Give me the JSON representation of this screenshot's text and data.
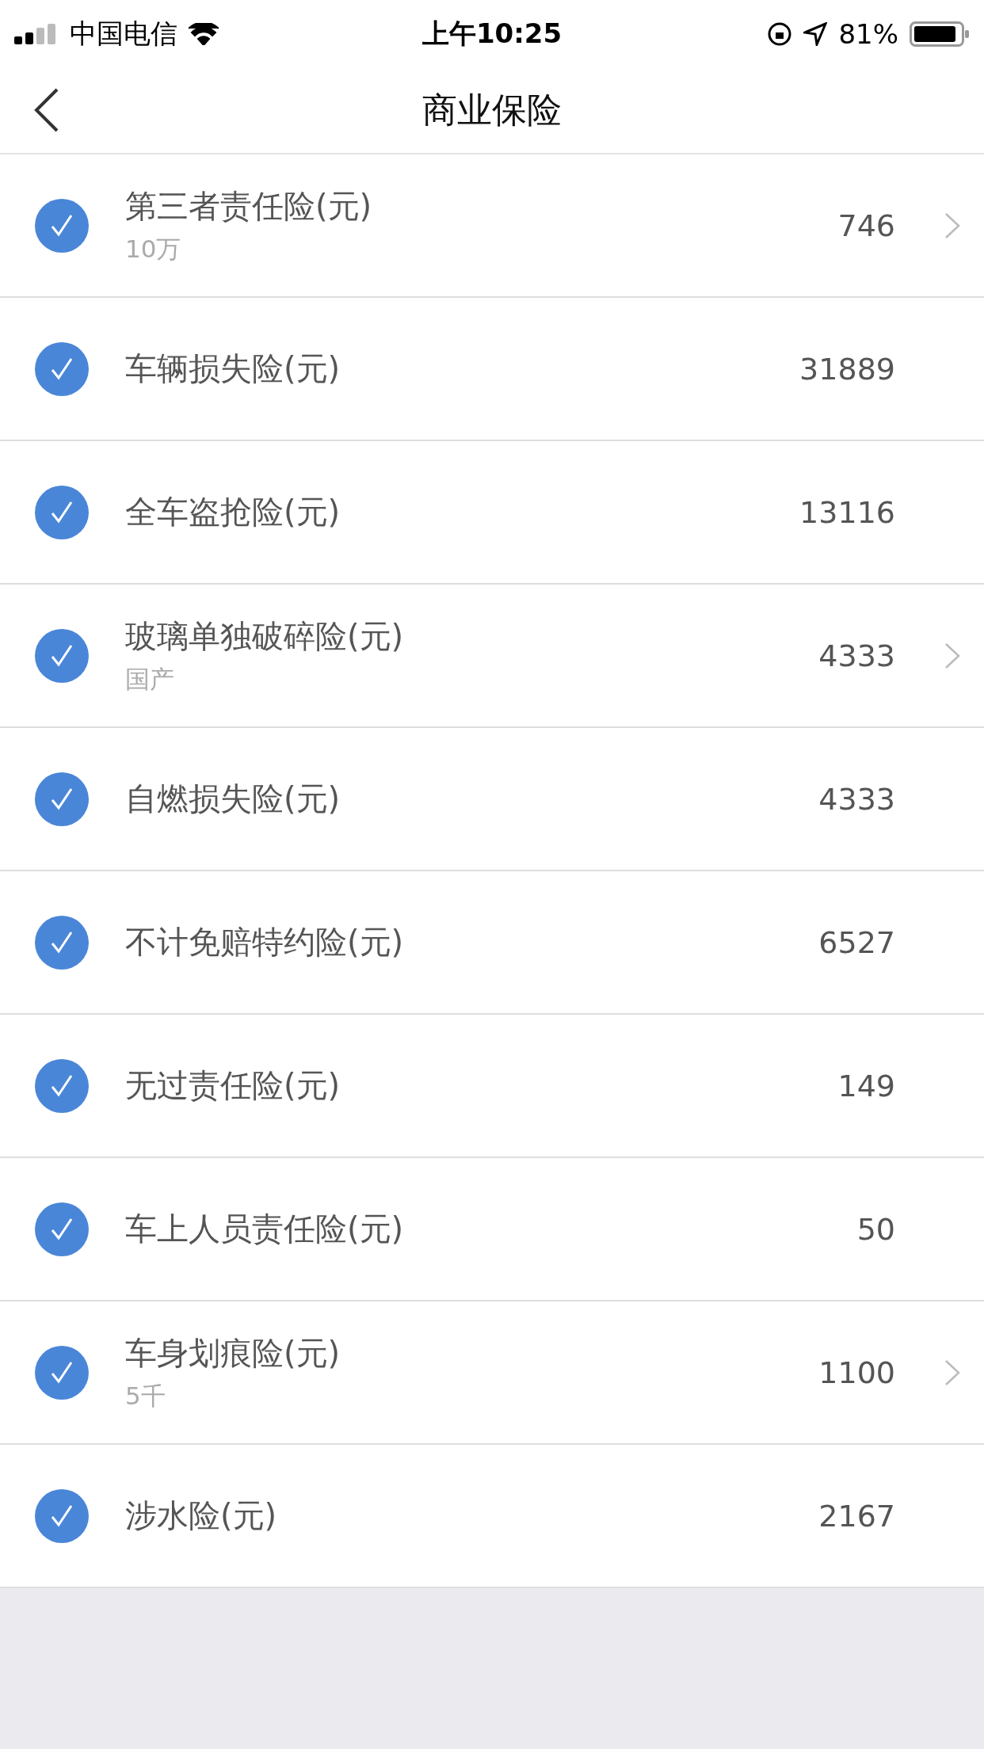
{
  "status_bar": {
    "carrier": "中国电信",
    "time": "上午10:25",
    "battery": "81%"
  },
  "nav": {
    "title": "商业保险"
  },
  "items": [
    {
      "label": "第三者责任险(元)",
      "sub": "10万",
      "value": "746",
      "checked": true,
      "chevron": true
    },
    {
      "label": "车辆损失险(元)",
      "value": "31889",
      "checked": true,
      "chevron": false
    },
    {
      "label": "全车盗抢险(元)",
      "value": "13116",
      "checked": true,
      "chevron": false
    },
    {
      "label": "玻璃单独破碎险(元)",
      "sub": "国产",
      "value": "4333",
      "checked": true,
      "chevron": true
    },
    {
      "label": "自燃损失险(元)",
      "value": "4333",
      "checked": true,
      "chevron": false
    },
    {
      "label": "不计免赔特约险(元)",
      "value": "6527",
      "checked": true,
      "chevron": false
    },
    {
      "label": "无过责任险(元)",
      "value": "149",
      "checked": true,
      "chevron": false
    },
    {
      "label": "车上人员责任险(元)",
      "value": "50",
      "checked": true,
      "chevron": false
    },
    {
      "label": "车身划痕险(元)",
      "sub": "5千",
      "value": "1100",
      "checked": true,
      "chevron": true
    },
    {
      "label": "涉水险(元)",
      "value": "2167",
      "checked": true,
      "chevron": false
    }
  ]
}
